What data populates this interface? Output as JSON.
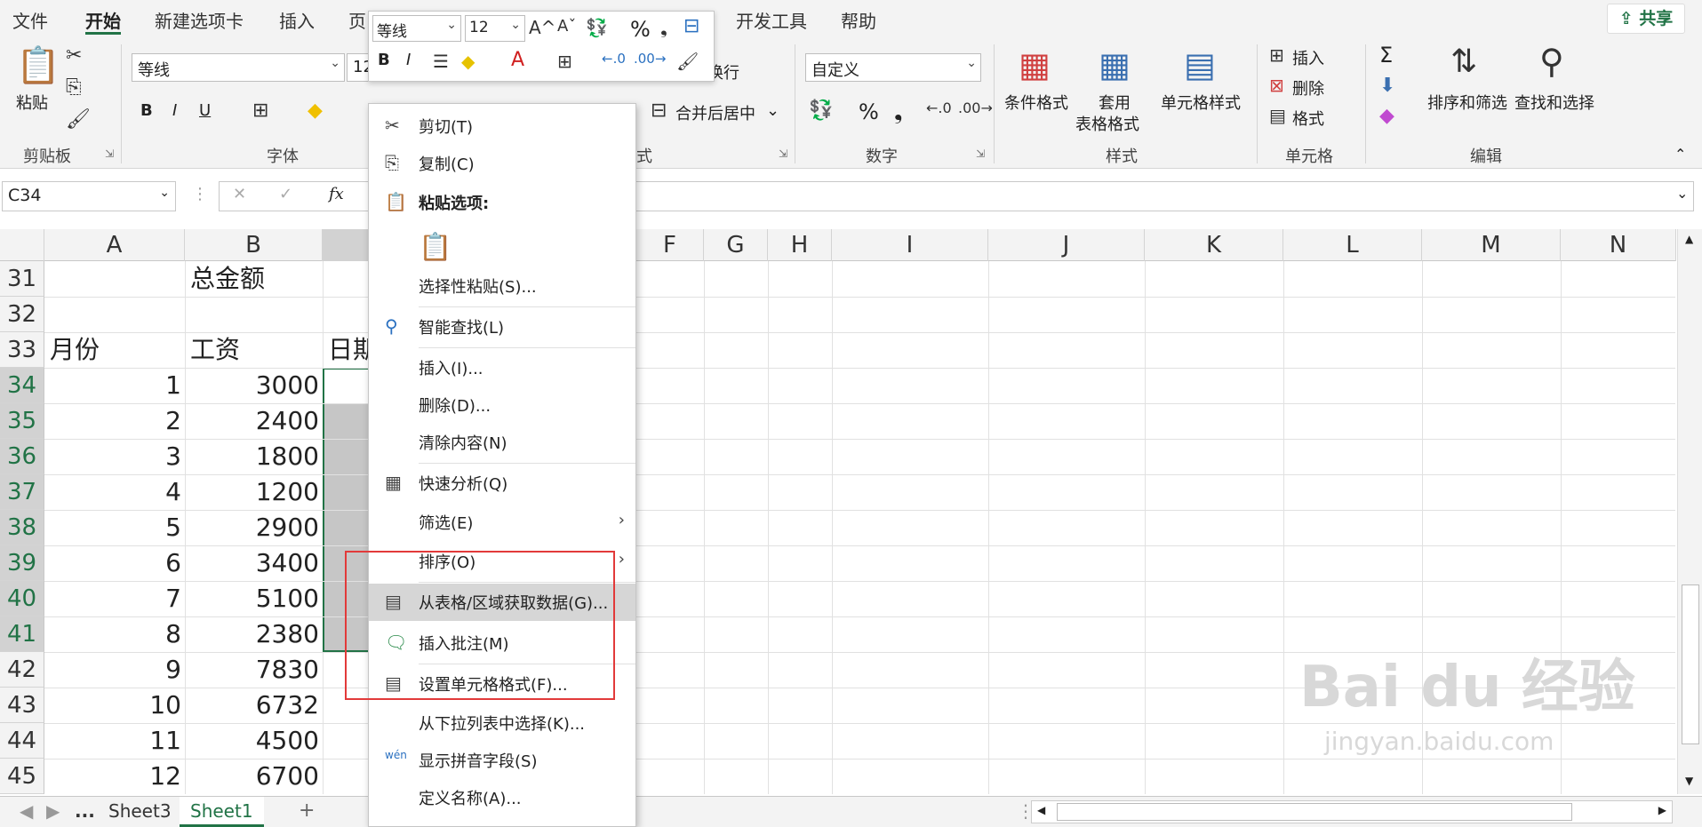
{
  "tabs": [
    "文件",
    "开始",
    "新建选项卡",
    "插入",
    "页",
    "开发工具",
    "帮助"
  ],
  "share_label": "共享",
  "ribbon": {
    "clipboard": {
      "paste": "粘贴",
      "label": "剪贴板"
    },
    "font": {
      "name": "等线",
      "size": "12",
      "bold": "B",
      "italic": "I",
      "underline": "U",
      "label": "字体"
    },
    "alignment": {
      "merge": "合并后居中",
      "wrap": "换行",
      "label_tail": "式"
    },
    "number": {
      "format": "自定义",
      "percent": "%",
      "comma": "❟",
      "label": "数字"
    },
    "styles": {
      "conditional": "条件格式",
      "table_l1": "套用",
      "table_l2": "表格格式",
      "cell_styles": "单元格样式",
      "label": "样式"
    },
    "cells": {
      "insert": "插入",
      "delete": "删除",
      "format": "格式",
      "label": "单元格"
    },
    "editing": {
      "sort_filter": "排序和筛选",
      "find_select": "查找和选择",
      "label": "编辑",
      "sigma": "Σ"
    }
  },
  "formula_bar": {
    "name_box": "C34",
    "fx": "fx",
    "cancel": "✕",
    "enter": "✓"
  },
  "columns": [
    "A",
    "B",
    "F",
    "G",
    "H",
    "I",
    "J",
    "K",
    "L",
    "M",
    "N"
  ],
  "rows": [
    {
      "num": "31",
      "a": "",
      "b": "总金额",
      "c": ""
    },
    {
      "num": "32",
      "a": "",
      "b": "",
      "c": ""
    },
    {
      "num": "33",
      "a": "月份",
      "b": "工资",
      "c": "日期"
    },
    {
      "num": "34",
      "a": "1",
      "b": "3000",
      "c": ""
    },
    {
      "num": "35",
      "a": "2",
      "b": "2400",
      "c": ""
    },
    {
      "num": "36",
      "a": "3",
      "b": "1800",
      "c": ""
    },
    {
      "num": "37",
      "a": "4",
      "b": "1200",
      "c": ""
    },
    {
      "num": "38",
      "a": "5",
      "b": "2900",
      "c": ""
    },
    {
      "num": "39",
      "a": "6",
      "b": "3400",
      "c": ""
    },
    {
      "num": "40",
      "a": "7",
      "b": "5100",
      "c": ""
    },
    {
      "num": "41",
      "a": "8",
      "b": "2380",
      "c": ""
    },
    {
      "num": "42",
      "a": "9",
      "b": "7830",
      "c": ""
    },
    {
      "num": "43",
      "a": "10",
      "b": "6732",
      "c": ""
    },
    {
      "num": "44",
      "a": "11",
      "b": "4500",
      "c": ""
    },
    {
      "num": "45",
      "a": "12",
      "b": "6700",
      "c": ""
    }
  ],
  "sheets": {
    "ellipsis": "...",
    "sheet3": "Sheet3",
    "sheet1": "Sheet1",
    "add": "+"
  },
  "mini_toolbar": {
    "font": "等线",
    "size": "12",
    "bold": "B",
    "italic": "I",
    "percent": "%"
  },
  "context_menu": [
    {
      "label": "剪切(T)"
    },
    {
      "label": "复制(C)"
    },
    {
      "label": "粘贴选项:"
    },
    {
      "label": "选择性粘贴(S)..."
    },
    {
      "label": "智能查找(L)"
    },
    {
      "label": "插入(I)..."
    },
    {
      "label": "删除(D)..."
    },
    {
      "label": "清除内容(N)"
    },
    {
      "label": "快速分析(Q)"
    },
    {
      "label": "筛选(E)"
    },
    {
      "label": "排序(O)"
    },
    {
      "label": "从表格/区域获取数据(G)..."
    },
    {
      "label": "插入批注(M)"
    },
    {
      "label": "设置单元格格式(F)..."
    },
    {
      "label": "从下拉列表中选择(K)..."
    },
    {
      "label": "显示拼音字段(S)"
    },
    {
      "label": "定义名称(A)..."
    }
  ],
  "watermark": {
    "brand": "Bai du 经验",
    "url": "jingyan.baidu.com"
  },
  "colors": {
    "accent": "#217346",
    "highlight": "#e23a3a"
  }
}
